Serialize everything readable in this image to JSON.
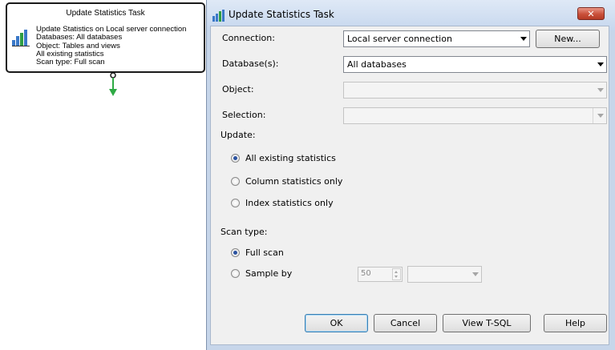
{
  "task_box": {
    "title": "Update Statistics Task",
    "lines": [
      "Update Statistics on Local server connection",
      "Databases: All databases",
      "Object: Tables and views",
      "All existing statistics",
      "Scan type: Full scan"
    ]
  },
  "dialog": {
    "title": "Update Statistics Task",
    "close_label": "✕",
    "connection": {
      "label": "Connection:",
      "value": "Local server connection",
      "new_button": "New..."
    },
    "databases": {
      "label": "Database(s):",
      "value": "All databases"
    },
    "object": {
      "label": "Object:",
      "value": ""
    },
    "selection": {
      "label": "Selection:",
      "value": ""
    },
    "update": {
      "label": "Update:",
      "options": [
        "All existing statistics",
        "Column statistics only",
        "Index statistics only"
      ],
      "selected": "All existing statistics"
    },
    "scan_type": {
      "label": "Scan type:",
      "options": [
        "Full scan",
        "Sample by"
      ],
      "selected": "Full scan",
      "sample_value": "50",
      "sample_unit": ""
    },
    "buttons": {
      "ok": "OK",
      "cancel": "Cancel",
      "view_tsql": "View T-SQL",
      "help": "Help"
    }
  }
}
